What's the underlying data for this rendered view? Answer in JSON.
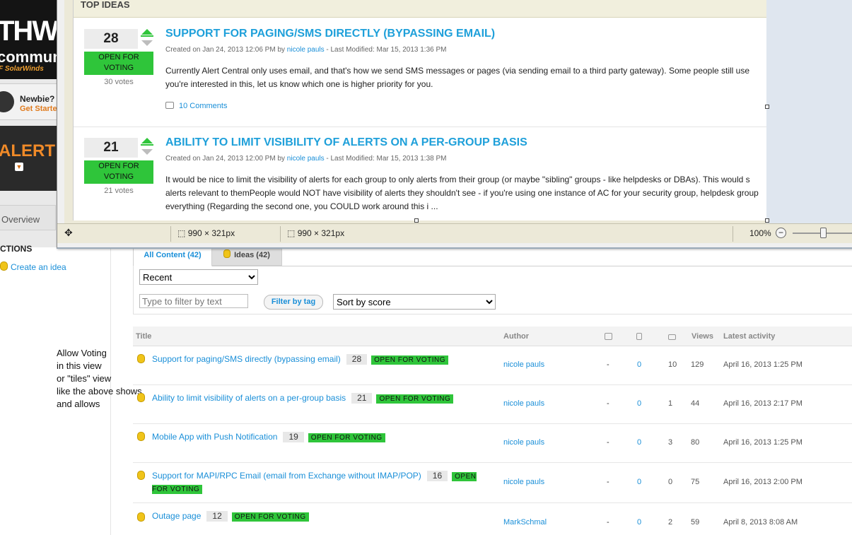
{
  "sidebar": {
    "logo_big": "THWAC",
    "logo_mid": "communi",
    "logo_small": "F SolarWinds",
    "newbie_title": "Newbie?",
    "newbie_subtitle": "Get Starte",
    "alerts_label": "ALERT",
    "overview_label": "Overview",
    "actions_title": "CTIONS",
    "create_idea": "Create an idea"
  },
  "annotation": "Allow Voting\nin this view\nor \"tiles\" view\nlike the above shows\nand allows",
  "tabs": {
    "all": "All Content (42)",
    "ideas": "Ideas (42)"
  },
  "filters": {
    "recent": "Recent",
    "filter_placeholder": "Type to filter by text",
    "filter_tag": "Filter by tag",
    "sort": "Sort by score"
  },
  "table": {
    "headers": {
      "title": "Title",
      "author": "Author",
      "views": "Views",
      "latest": "Latest activity"
    },
    "rows": [
      {
        "title": "Support for paging/SMS directly (bypassing email)",
        "score": "28",
        "status": "OPEN FOR VOTING",
        "author": "nicole pauls",
        "likes": "-",
        "bookmarks": "0",
        "comments": "10",
        "views": "129",
        "activity": "April 16, 2013 1:25 PM"
      },
      {
        "title": "Ability to limit visibility of alerts on a per-group basis",
        "score": "21",
        "status": "OPEN FOR VOTING",
        "author": "nicole pauls",
        "likes": "-",
        "bookmarks": "0",
        "comments": "1",
        "views": "44",
        "activity": "April 16, 2013 2:17 PM"
      },
      {
        "title": "Mobile App with Push Notification",
        "score": "19",
        "status": "OPEN FOR VOTING",
        "author": "nicole pauls",
        "likes": "-",
        "bookmarks": "0",
        "comments": "3",
        "views": "80",
        "activity": "April 16, 2013 1:25 PM"
      },
      {
        "title": "Support for MAPI/RPC Email (email from Exchange without IMAP/POP)",
        "score": "16",
        "status": "OPEN FOR VOTING",
        "author": "nicole pauls",
        "likes": "-",
        "bookmarks": "0",
        "comments": "0",
        "views": "75",
        "activity": "April 16, 2013 2:00 PM"
      },
      {
        "title": "Outage page",
        "score": "12",
        "status": "OPEN FOR VOTING",
        "author": "MarkSchmal",
        "likes": "-",
        "bookmarks": "0",
        "comments": "2",
        "views": "59",
        "activity": "April 8, 2013 8:08 AM"
      }
    ]
  },
  "overlay": {
    "section_title": "TOP IDEAS",
    "cards": [
      {
        "score": "28",
        "status_line1": "OPEN FOR",
        "status_line2": "VOTING",
        "votes": "30 votes",
        "title": "SUPPORT FOR PAGING/SMS DIRECTLY (BYPASSING EMAIL)",
        "created": "Created on Jan 24, 2013 12:06 PM by",
        "author": "nicole pauls",
        "modified": "- Last Modified: Mar 15, 2013 1:36 PM",
        "body1": "Currently Alert Central only uses email, and that's how we send SMS messages or pages (via sending email to a third party gateway). Some people still use",
        "body2": "you're interested in this, let us know which one is higher priority for you.",
        "comments": "10 Comments"
      },
      {
        "score": "21",
        "status_line1": "OPEN FOR",
        "status_line2": "VOTING",
        "votes": "21 votes",
        "title": "ABILITY TO LIMIT VISIBILITY OF ALERTS ON A PER-GROUP BASIS",
        "created": "Created on Jan 24, 2013 12:00 PM by",
        "author": "nicole pauls",
        "modified": "- Last Modified: Mar 15, 2013 1:38 PM",
        "body1": "It would be nice to limit the visibility of alerts for each group to only alerts from their group (or maybe \"sibling\" groups - like helpdesks or DBAs).   This would s",
        "body2": "alerts relevant to themPeople would NOT have visibility of alerts they shouldn't see - if you're using one instance of AC for your security group, helpdesk group",
        "body3": "everything  (Regarding the second one, you COULD work around this i ..."
      }
    ]
  },
  "statusbar": {
    "size1": "990 × 321px",
    "size2": "990 × 321px",
    "zoom": "100%"
  },
  "colors": {
    "link": "#1a8fd8",
    "open_status": "#2fc53a",
    "title_blue": "#1fa0da"
  }
}
